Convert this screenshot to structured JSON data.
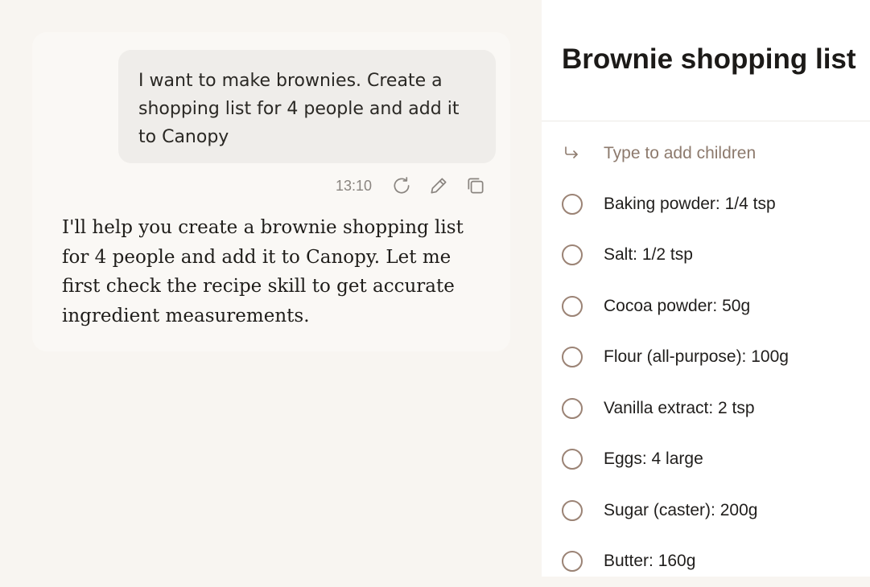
{
  "chat": {
    "user_message": "I want to make brownies. Create a shopping list for 4 people and add it to Canopy",
    "timestamp": "13:10",
    "actions": [
      "refresh-icon",
      "pencil-icon",
      "copy-icon"
    ],
    "assistant_message": "I'll help you create a brownie shopping list for 4 people and add it to Canopy. Let me first check the recipe skill to get accurate ingredient measurements."
  },
  "list": {
    "title": "Brownie shopping list",
    "add_placeholder": "Type to add children",
    "items": [
      {
        "label": "Baking powder: 1/4 tsp",
        "checked": false
      },
      {
        "label": "Salt: 1/2 tsp",
        "checked": false
      },
      {
        "label": "Cocoa powder: 50g",
        "checked": false
      },
      {
        "label": "Flour (all-purpose): 100g",
        "checked": false
      },
      {
        "label": "Vanilla extract: 2 tsp",
        "checked": false
      },
      {
        "label": "Eggs: 4 large",
        "checked": false
      },
      {
        "label": "Sugar (caster): 200g",
        "checked": false
      },
      {
        "label": "Butter: 160g",
        "checked": false
      }
    ]
  },
  "colors": {
    "page_background": "#f8f5f1",
    "user_bubble": "#efedea",
    "checkbox_border": "#9b8375",
    "placeholder_text": "#8d7a6d"
  }
}
